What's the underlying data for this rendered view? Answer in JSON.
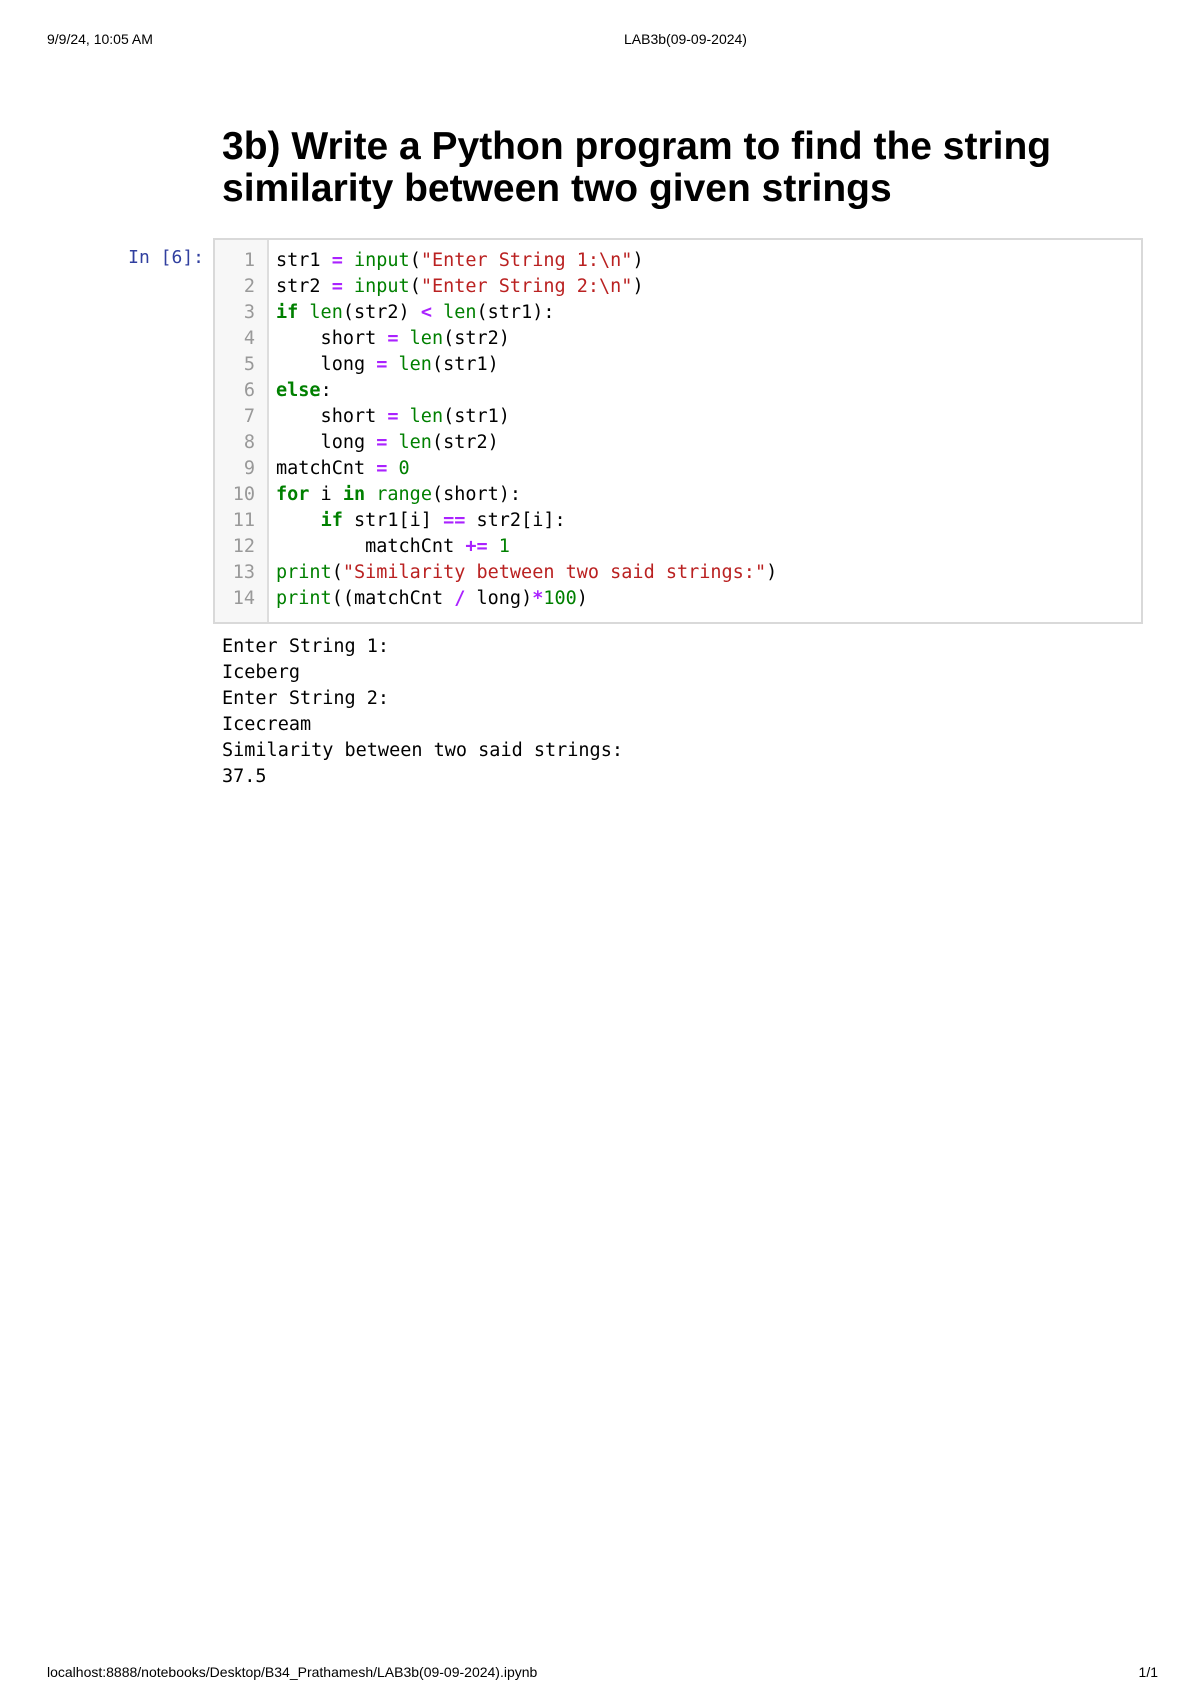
{
  "header": {
    "datetime": "9/9/24, 10:05 AM",
    "doc_title": "LAB3b(09-09-2024)"
  },
  "title": "3b) Write a Python program to find the string similarity between two given strings",
  "cell": {
    "prompt": "In [6]:",
    "lines": [
      [
        [
          "",
          "str1 "
        ],
        [
          "op",
          "="
        ],
        [
          "",
          " "
        ],
        [
          "bi",
          "input"
        ],
        [
          "",
          "("
        ],
        [
          "st",
          "\"Enter String 1:\\n\""
        ],
        [
          "",
          ")"
        ]
      ],
      [
        [
          "",
          "str2 "
        ],
        [
          "op",
          "="
        ],
        [
          "",
          " "
        ],
        [
          "bi",
          "input"
        ],
        [
          "",
          "("
        ],
        [
          "st",
          "\"Enter String 2:\\n\""
        ],
        [
          "",
          ")"
        ]
      ],
      [
        [
          "kw",
          "if"
        ],
        [
          "",
          " "
        ],
        [
          "bi",
          "len"
        ],
        [
          "",
          "(str2) "
        ],
        [
          "op",
          "<"
        ],
        [
          "",
          " "
        ],
        [
          "bi",
          "len"
        ],
        [
          "",
          "(str1):"
        ]
      ],
      [
        [
          "",
          "    short "
        ],
        [
          "op",
          "="
        ],
        [
          "",
          " "
        ],
        [
          "bi",
          "len"
        ],
        [
          "",
          "(str2)"
        ]
      ],
      [
        [
          "",
          "    long "
        ],
        [
          "op",
          "="
        ],
        [
          "",
          " "
        ],
        [
          "bi",
          "len"
        ],
        [
          "",
          "(str1)"
        ]
      ],
      [
        [
          "kw",
          "else"
        ],
        [
          "",
          ":"
        ]
      ],
      [
        [
          "",
          "    short "
        ],
        [
          "op",
          "="
        ],
        [
          "",
          " "
        ],
        [
          "bi",
          "len"
        ],
        [
          "",
          "(str1)"
        ]
      ],
      [
        [
          "",
          "    long "
        ],
        [
          "op",
          "="
        ],
        [
          "",
          " "
        ],
        [
          "bi",
          "len"
        ],
        [
          "",
          "(str2)"
        ]
      ],
      [
        [
          "",
          "matchCnt "
        ],
        [
          "op",
          "="
        ],
        [
          "",
          " "
        ],
        [
          "nm",
          "0"
        ]
      ],
      [
        [
          "kw",
          "for"
        ],
        [
          "",
          " i "
        ],
        [
          "kw",
          "in"
        ],
        [
          "",
          " "
        ],
        [
          "bi",
          "range"
        ],
        [
          "",
          "(short):"
        ]
      ],
      [
        [
          "",
          "    "
        ],
        [
          "kw",
          "if"
        ],
        [
          "",
          " str1[i] "
        ],
        [
          "op",
          "=="
        ],
        [
          "",
          " str2[i]:"
        ]
      ],
      [
        [
          "",
          "        matchCnt "
        ],
        [
          "op",
          "+="
        ],
        [
          "",
          " "
        ],
        [
          "nm",
          "1"
        ]
      ],
      [
        [
          "bi",
          "print"
        ],
        [
          "",
          "("
        ],
        [
          "st",
          "\"Similarity between two said strings:\""
        ],
        [
          "",
          ")"
        ]
      ],
      [
        [
          "bi",
          "print"
        ],
        [
          "",
          "((matchCnt "
        ],
        [
          "op",
          "/"
        ],
        [
          "",
          " long)"
        ],
        [
          "op",
          "*"
        ],
        [
          "nm",
          "100"
        ],
        [
          "",
          ")"
        ]
      ]
    ]
  },
  "output": [
    "Enter String 1:",
    "Iceberg",
    "Enter String 2:",
    "Icecream",
    "Similarity between two said strings:",
    "37.5"
  ],
  "footer": {
    "url": "localhost:8888/notebooks/Desktop/B34_Prathamesh/LAB3b(09-09-2024).ipynb",
    "page": "1/1"
  }
}
